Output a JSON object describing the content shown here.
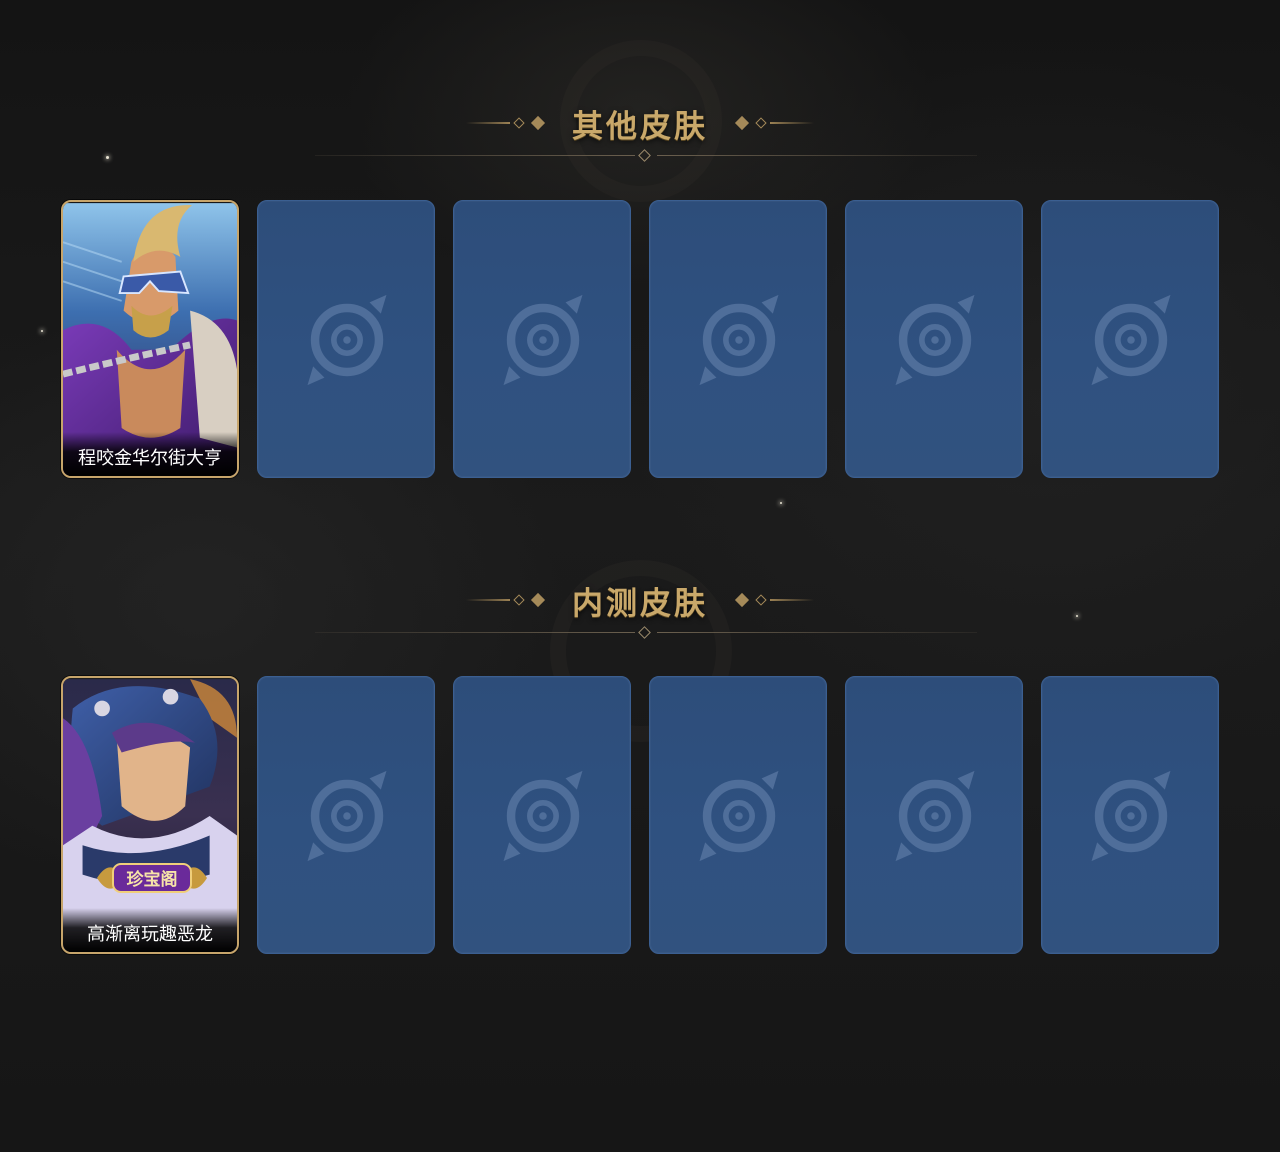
{
  "sections": [
    {
      "title": "其他皮肤",
      "cards": [
        {
          "label": "程咬金华尔街大亨",
          "filled": true,
          "badge": ""
        },
        {
          "label": "",
          "filled": false
        },
        {
          "label": "",
          "filled": false
        },
        {
          "label": "",
          "filled": false
        },
        {
          "label": "",
          "filled": false
        },
        {
          "label": "",
          "filled": false
        }
      ]
    },
    {
      "title": "内测皮肤",
      "cards": [
        {
          "label": "高渐离玩趣恶龙",
          "filled": true,
          "badge": "珍宝阁"
        },
        {
          "label": "",
          "filled": false
        },
        {
          "label": "",
          "filled": false
        },
        {
          "label": "",
          "filled": false
        },
        {
          "label": "",
          "filled": false
        },
        {
          "label": "",
          "filled": false
        }
      ]
    }
  ],
  "colors": {
    "title_gold": "#c9a86a",
    "card_frame_gold": "#c7a56b",
    "empty_card_blue": "#2f5180",
    "background": "#171717"
  },
  "icons": {
    "empty_slot": "game-logo-placeholder-icon",
    "ornament": "diamond-ornament-icon"
  }
}
